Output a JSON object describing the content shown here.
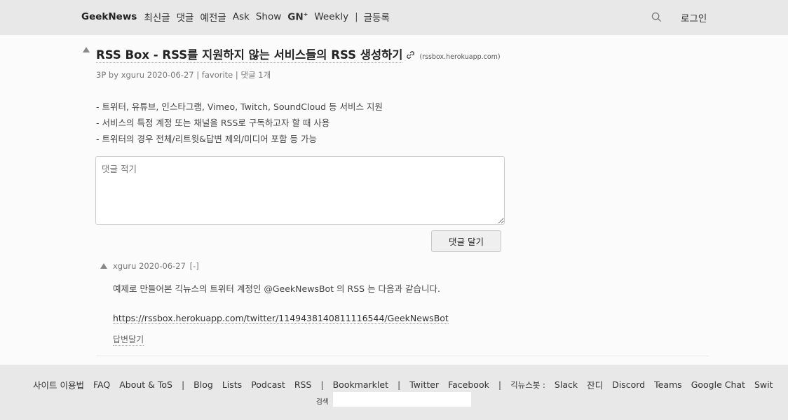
{
  "nav": {
    "brand": "GeekNews",
    "items": [
      "최신글",
      "댓글",
      "예전글",
      "Ask",
      "Show"
    ],
    "gn_label": "GN",
    "gn_sup": "+",
    "weekly": "Weekly",
    "separator": "|",
    "submit": "글등록",
    "login": "로그인"
  },
  "post": {
    "title": "RSS Box - RSS를 지원하지 않는 서비스들의 RSS 생성하기",
    "domain": "(rssbox.herokuapp.com)",
    "points": "3P",
    "by": "by",
    "author": "xguru",
    "date": "2020-06-27",
    "sep": "|",
    "favorite": "favorite",
    "comments": "댓글 1개",
    "body": [
      "- 트위터, 유튜브, 인스타그램, Vimeo, Twitch, SoundCloud 등 서비스 지원",
      "- 서비스의 특정 계정 또는 채널을 RSS로 구독하고자 할 때 사용",
      "- 트위터의 경우 전체/리트윗&답변 제외/미디어 포함 등 가능"
    ]
  },
  "comment_form": {
    "placeholder": "댓글 적기",
    "submit_label": "댓글 달기"
  },
  "comment": {
    "author": "xguru",
    "date": "2020-06-27",
    "collapse": "[-]",
    "text": "예제로 만들어본 긱뉴스의 트위터 계정인 @GeekNewsBot 의 RSS 는 다음과 같습니다.",
    "link": "https://rssbox.herokuapp.com/twitter/1149438140811116544/GeekNewsBot",
    "reply": "답변달기"
  },
  "footer": {
    "site_terms": "사이트 이용법",
    "faq": "FAQ",
    "about": "About & ToS",
    "blog": "Blog",
    "lists": "Lists",
    "podcast": "Podcast",
    "rss": "RSS",
    "bookmarklet": "Bookmarklet",
    "twitter": "Twitter",
    "facebook": "Facebook",
    "bots_label": "긱뉴스봇 :",
    "slack": "Slack",
    "jandi": "잔디",
    "discord": "Discord",
    "teams": "Teams",
    "google_chat": "Google Chat",
    "swit": "Swit",
    "sep": "|",
    "search_label": "검색"
  },
  "icons": {
    "search": "search-icon",
    "link": "chain-link-icon",
    "upvote": "upvote-triangle-icon"
  },
  "colors": {
    "header_bg": "#e8e8e8",
    "content_bg": "#fbfbfb",
    "text": "#333333"
  }
}
